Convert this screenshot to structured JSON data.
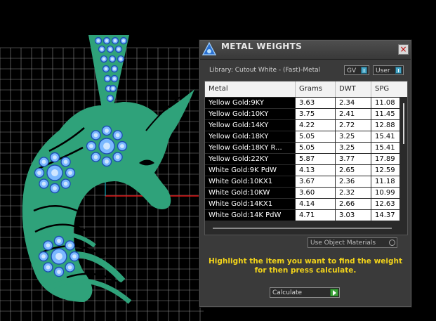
{
  "panel": {
    "title": "METAL WEIGHTS",
    "close_label": "×",
    "library_label": "Library: Cutout White - (Fast)-Metal",
    "toggle_gv": "GV",
    "toggle_user": "User",
    "use_materials_label": "Use Object Materials",
    "hint": "Highlight the item you want to find the weight for then press calculate.",
    "calculate_label": "Calculate"
  },
  "table": {
    "columns": [
      "Metal",
      "Grams",
      "DWT",
      "SPG"
    ],
    "rows": [
      [
        "Yellow Gold:9KY",
        "3.63",
        "2.34",
        "11.08"
      ],
      [
        "Yellow Gold:10KY",
        "3.75",
        "2.41",
        "11.45"
      ],
      [
        "Yellow Gold:14KY",
        "4.22",
        "2.72",
        "12.88"
      ],
      [
        "Yellow Gold:18KY",
        "5.05",
        "3.25",
        "15.41"
      ],
      [
        "Yellow Gold:18KY R...",
        "5.05",
        "3.25",
        "15.41"
      ],
      [
        "Yellow Gold:22KY",
        "5.87",
        "3.77",
        "17.89"
      ],
      [
        "White Gold:9K PdW",
        "4.13",
        "2.65",
        "12.59"
      ],
      [
        "White Gold:10KX1",
        "3.67",
        "2.36",
        "11.18"
      ],
      [
        "White Gold:10KW",
        "3.60",
        "2.32",
        "10.99"
      ],
      [
        "White Gold:14KX1",
        "4.14",
        "2.66",
        "12.63"
      ],
      [
        "White Gold:14K PdW",
        "4.71",
        "3.03",
        "14.37"
      ]
    ]
  },
  "colors": {
    "model": "#2fa27a",
    "gem": "#7ab8ff",
    "grid": "#8a8a8a",
    "hint": "#f2d31a",
    "knob": "#4aa7c6"
  }
}
